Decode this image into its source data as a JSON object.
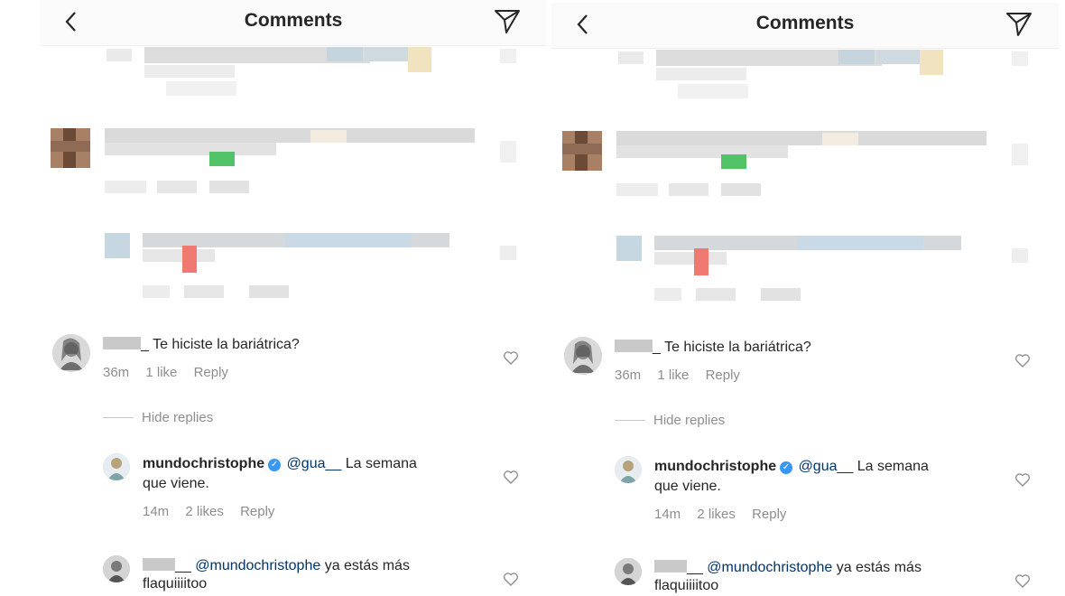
{
  "panels": [
    {
      "header": {
        "title": "Comments"
      },
      "comments": {
        "c1": {
          "suffix": "_",
          "text": "Te hiciste la bariátrica?",
          "time": "36m",
          "likes": "1 like",
          "reply": "Reply"
        },
        "hide_replies": "Hide replies",
        "r1": {
          "username": "mundochristophe",
          "mention": "@gua__",
          "text_a": "La semana",
          "text_b": "que viene.",
          "time": "14m",
          "likes": "2 likes",
          "reply": "Reply"
        },
        "r2": {
          "suffix": "__",
          "mention": "@mundochristophe",
          "text_a": "ya estás más",
          "text_b": "flaquiiiitoo"
        }
      }
    },
    {
      "header": {
        "title": "Comments"
      },
      "comments": {
        "c1": {
          "suffix": "_",
          "text": "Te hiciste la bariátrica?",
          "time": "36m",
          "likes": "1 like",
          "reply": "Reply"
        },
        "hide_replies": "Hide replies",
        "r1": {
          "username": "mundochristophe",
          "mention": "@gua__",
          "text_a": "La semana",
          "text_b": "que viene.",
          "time": "14m",
          "likes": "2 likes",
          "reply": "Reply"
        },
        "r2": {
          "suffix": "__",
          "mention": "@mundochristophe",
          "text_a": "ya estás más",
          "text_b": "flaquiiiitoo"
        }
      }
    }
  ],
  "icons": {
    "back": "chevron-left-icon",
    "send": "paper-plane-icon",
    "like": "heart-outline-icon",
    "verified": "verified-badge-icon"
  },
  "colors": {
    "text": "#262626",
    "secondary": "#8e8e8e",
    "mention": "#003569",
    "verified": "#3897f0"
  }
}
